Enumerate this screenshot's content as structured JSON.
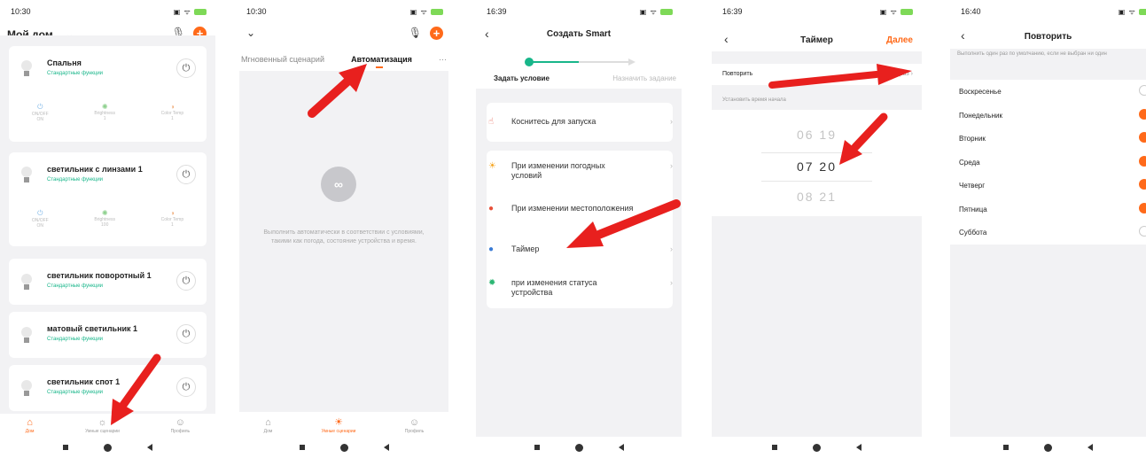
{
  "status": {
    "p1_time": "10:30",
    "p2_time": "10:30",
    "p3_time": "16:39",
    "p4_time": "16:39",
    "p5_time": "16:40"
  },
  "phone1": {
    "home_title": "Мой дом ..",
    "devices": [
      {
        "name": "Спальня",
        "func": "Стандартные функции",
        "controls": [
          "ON/OFF",
          "Brightness",
          "Color Temp"
        ],
        "ctrl_vals": [
          "ON",
          "1",
          "1"
        ]
      },
      {
        "name": "светильник с линзами 1",
        "func": "Стандартные функции",
        "controls": [
          "ON/OFF",
          "Brightness",
          "Color Temp"
        ],
        "ctrl_vals": [
          "ON",
          "100",
          "1"
        ]
      },
      {
        "name": "светильник поворотный 1",
        "func": "Стандартные функции"
      },
      {
        "name": "матовый светильник 1",
        "func": "Стандартные функции"
      },
      {
        "name": "светильник спот 1",
        "func": "Стандартные функции"
      }
    ],
    "tabs": [
      "Дом",
      "Умные сценарии",
      "Профиль"
    ]
  },
  "phone2": {
    "tab1": "Мгновенный сценарий",
    "tab2": "Автоматизация",
    "more": "···",
    "empty_text": "Выполнить автоматически в соответствии с условиями, такими как погода, состояние устройства и время.",
    "tabs": [
      "Дом",
      "Умные сценарии",
      "Профиль"
    ]
  },
  "phone3": {
    "title": "Создать Smart",
    "step1": "Задать условие",
    "step2": "Назначить задание",
    "rows": [
      {
        "text": "Коснитесь для запуска"
      },
      {
        "text": "При изменении погодных условий"
      },
      {
        "text": "При изменении местоположения"
      },
      {
        "text": "Таймер"
      },
      {
        "text": "при изменения статуса устройства"
      }
    ]
  },
  "phone4": {
    "title": "Таймер",
    "next": "Далее",
    "repeat_label": "Повторить",
    "repeat_value": "Один раз",
    "start_label": "Установить время начала",
    "picker": [
      "06  19",
      "07  20",
      "08  21"
    ]
  },
  "phone5": {
    "title": "Повторить",
    "note": "Выполнить один раз по умолчанию, если не выбран ни один",
    "days": [
      {
        "name": "Воскресенье",
        "checked": false
      },
      {
        "name": "Понедельник",
        "checked": true
      },
      {
        "name": "Вторник",
        "checked": true
      },
      {
        "name": "Среда",
        "checked": true
      },
      {
        "name": "Четверг",
        "checked": true
      },
      {
        "name": "Пятница",
        "checked": true
      },
      {
        "name": "Суббота",
        "checked": false
      }
    ]
  },
  "colors": {
    "accent": "#ff6a1a",
    "green": "#18b68a",
    "annotation": "#e8201e"
  }
}
